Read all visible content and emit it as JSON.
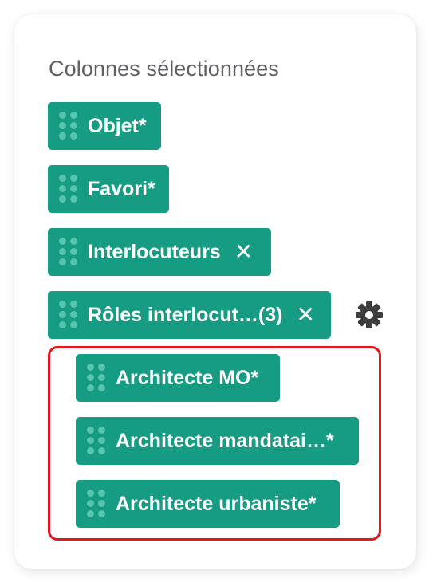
{
  "panel": {
    "title": "Colonnes sélectionnées"
  },
  "chips": [
    {
      "label": "Objet*"
    },
    {
      "label": "Favori*"
    },
    {
      "label": "Interlocuteurs",
      "remove": "✕"
    },
    {
      "label": "Rôles interlocut…(3)",
      "remove": "✕"
    }
  ],
  "sub_chips": [
    {
      "label": "Architecte MO*"
    },
    {
      "label": "Architecte mandatai…*"
    },
    {
      "label": "Architecte urbaniste*"
    }
  ],
  "icons": {
    "drag": "drag-handle-icon",
    "remove": "close-icon",
    "settings": "gear-icon"
  },
  "colors": {
    "chip_bg": "#169c83",
    "grip_dot": "#57c4ad",
    "highlight_border": "#e4161b",
    "title_text": "#5f6063",
    "settings_icon": "#3d3d3d"
  }
}
